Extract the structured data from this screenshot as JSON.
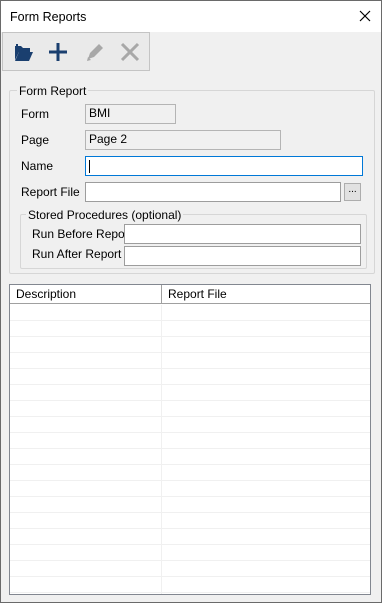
{
  "window": {
    "title": "Form Reports",
    "close_icon": "close-icon"
  },
  "toolbar": {
    "buttons": [
      {
        "name": "open-button",
        "icon": "open-folder-icon"
      },
      {
        "name": "add-button",
        "icon": "plus-icon"
      },
      {
        "name": "edit-button",
        "icon": "pencil-icon",
        "enabled": false
      },
      {
        "name": "delete-button",
        "icon": "x-icon",
        "enabled": false
      }
    ]
  },
  "form_report": {
    "group_label": "Form Report",
    "form_label": "Form",
    "form_value": "BMI",
    "page_label": "Page",
    "page_value": "Page 2",
    "name_label": "Name",
    "name_value": "",
    "report_file_label": "Report File",
    "report_file_value": "",
    "browse_label": "..."
  },
  "stored_procedures": {
    "group_label": "Stored Procedures (optional)",
    "run_before_label": "Run Before Report",
    "run_before_value": "",
    "run_after_label": "Run After Report",
    "run_after_value": ""
  },
  "reports_table": {
    "columns": [
      "Description",
      "Report File"
    ],
    "rows": []
  },
  "colors": {
    "accent": "#0078d7",
    "toolbar_icon": "#1a3f6f",
    "disabled_icon": "#a0a0a0"
  }
}
